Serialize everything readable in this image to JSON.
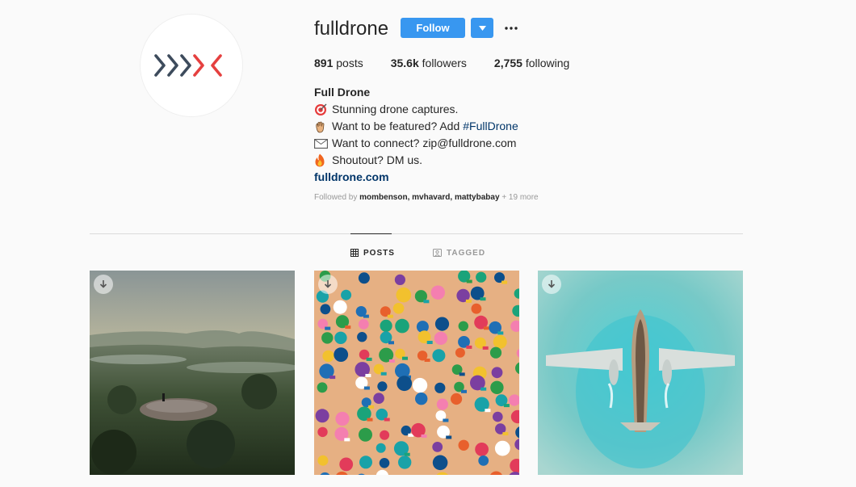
{
  "profile": {
    "username": "fulldrone",
    "follow_label": "Follow",
    "stats": {
      "posts_value": "891",
      "posts_label": "posts",
      "followers_value": "35.6k",
      "followers_label": "followers",
      "following_value": "2,755",
      "following_label": "following"
    },
    "full_name": "Full Drone",
    "bio_line1": "Stunning drone captures.",
    "bio_line2": "Want to be featured? Add",
    "bio_hashtag": "#FullDrone",
    "bio_line3": "Want to connect? zip@fulldrone.com",
    "bio_line4": "Shoutout? DM us.",
    "website": "fulldrone.com",
    "followed_by_prefix": "Followed by",
    "followed_by_users": "mombenson, mvhavard, mattybabay",
    "followed_by_more": "+ 19 more"
  },
  "tabs": {
    "posts": "POSTS",
    "tagged": "TAGGED"
  },
  "icons": {
    "emoji1": "target-emoji-icon",
    "emoji2": "raised-hand-emoji-icon",
    "emoji3": "envelope-emoji-icon",
    "emoji4": "fire-emoji-icon"
  },
  "colors": {
    "accent": "#3897f0",
    "link": "#003569",
    "logo_dark": "#3d4b5c",
    "logo_red": "#e5403f"
  }
}
